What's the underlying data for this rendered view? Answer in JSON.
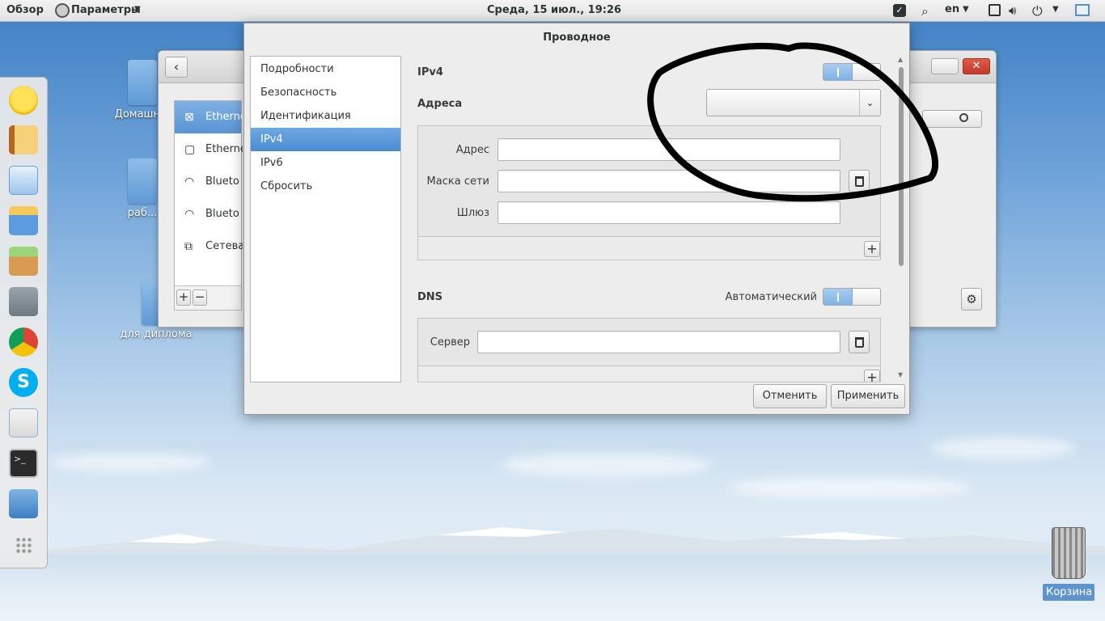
{
  "topbar": {
    "overview": "Обзор",
    "app_menu": "Параметры",
    "clock": "Среда, 15 июл., 19:26",
    "lang": "en"
  },
  "desktop": {
    "icons": [
      "Домашн...",
      "раб...",
      "для диплома"
    ],
    "trash_label": "Корзина"
  },
  "bg_window": {
    "items": [
      {
        "label": "Etherne",
        "icon": "ethernet-icon"
      },
      {
        "label": "Etherne",
        "icon": "ethernet-icon"
      },
      {
        "label": "Blueto",
        "icon": "wifi-icon"
      },
      {
        "label": "Blueto",
        "icon": "wifi-icon"
      },
      {
        "label": "Сетева",
        "icon": "network-icon"
      }
    ]
  },
  "dialog": {
    "title": "Проводное",
    "nav": [
      "Подробности",
      "Безопасность",
      "Идентификация",
      "IPv4",
      "IPv6",
      "Сбросить"
    ],
    "selected_nav": "IPv4",
    "ipv4_label": "IPv4",
    "addresses_label": "Адреса",
    "address_label": "Адрес",
    "netmask_label": "Маска сети",
    "gateway_label": "Шлюз",
    "dns_label": "DNS",
    "dns_auto_label": "Автоматический",
    "server_label": "Сервер",
    "cancel": "Отменить",
    "apply": "Применить"
  },
  "colors": {
    "selection": "#4a8bd3",
    "toggle_on": "#7fb3e6"
  }
}
